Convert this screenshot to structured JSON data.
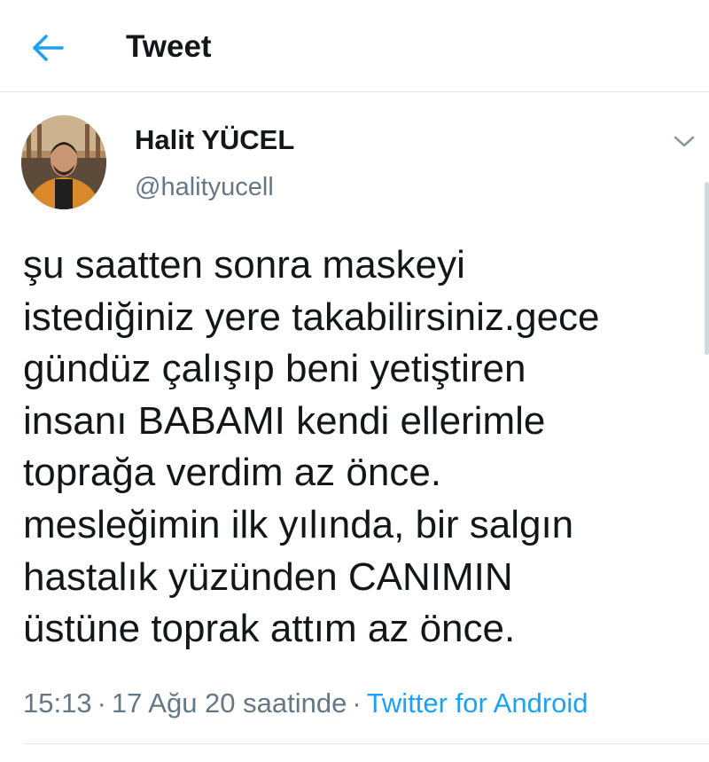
{
  "header": {
    "title": "Tweet",
    "back_icon": "back-arrow-icon"
  },
  "colors": {
    "accent": "#1da1f2",
    "text_primary": "#14171a",
    "text_secondary": "#657786",
    "divider": "#e1e8ed"
  },
  "tweet": {
    "author_name": "Halit YÜCEL",
    "author_handle": "@halityucell",
    "lines": [
      "şu saatten sonra maskeyi",
      "istediğiniz yere takabilirsiniz.gece",
      "gündüz çalışıp beni yetiştiren",
      "insanı BABAMI kendi ellerimle",
      "toprağa verdim az önce.",
      "mesleğimin ilk yılında, bir salgın",
      "hastalık yüzünden CANIMIN",
      "üstüne toprak attım az önce."
    ],
    "time": "15:13",
    "date": "17 Ağu 20 saatinde",
    "separator": "·",
    "source": "Twitter for Android"
  }
}
